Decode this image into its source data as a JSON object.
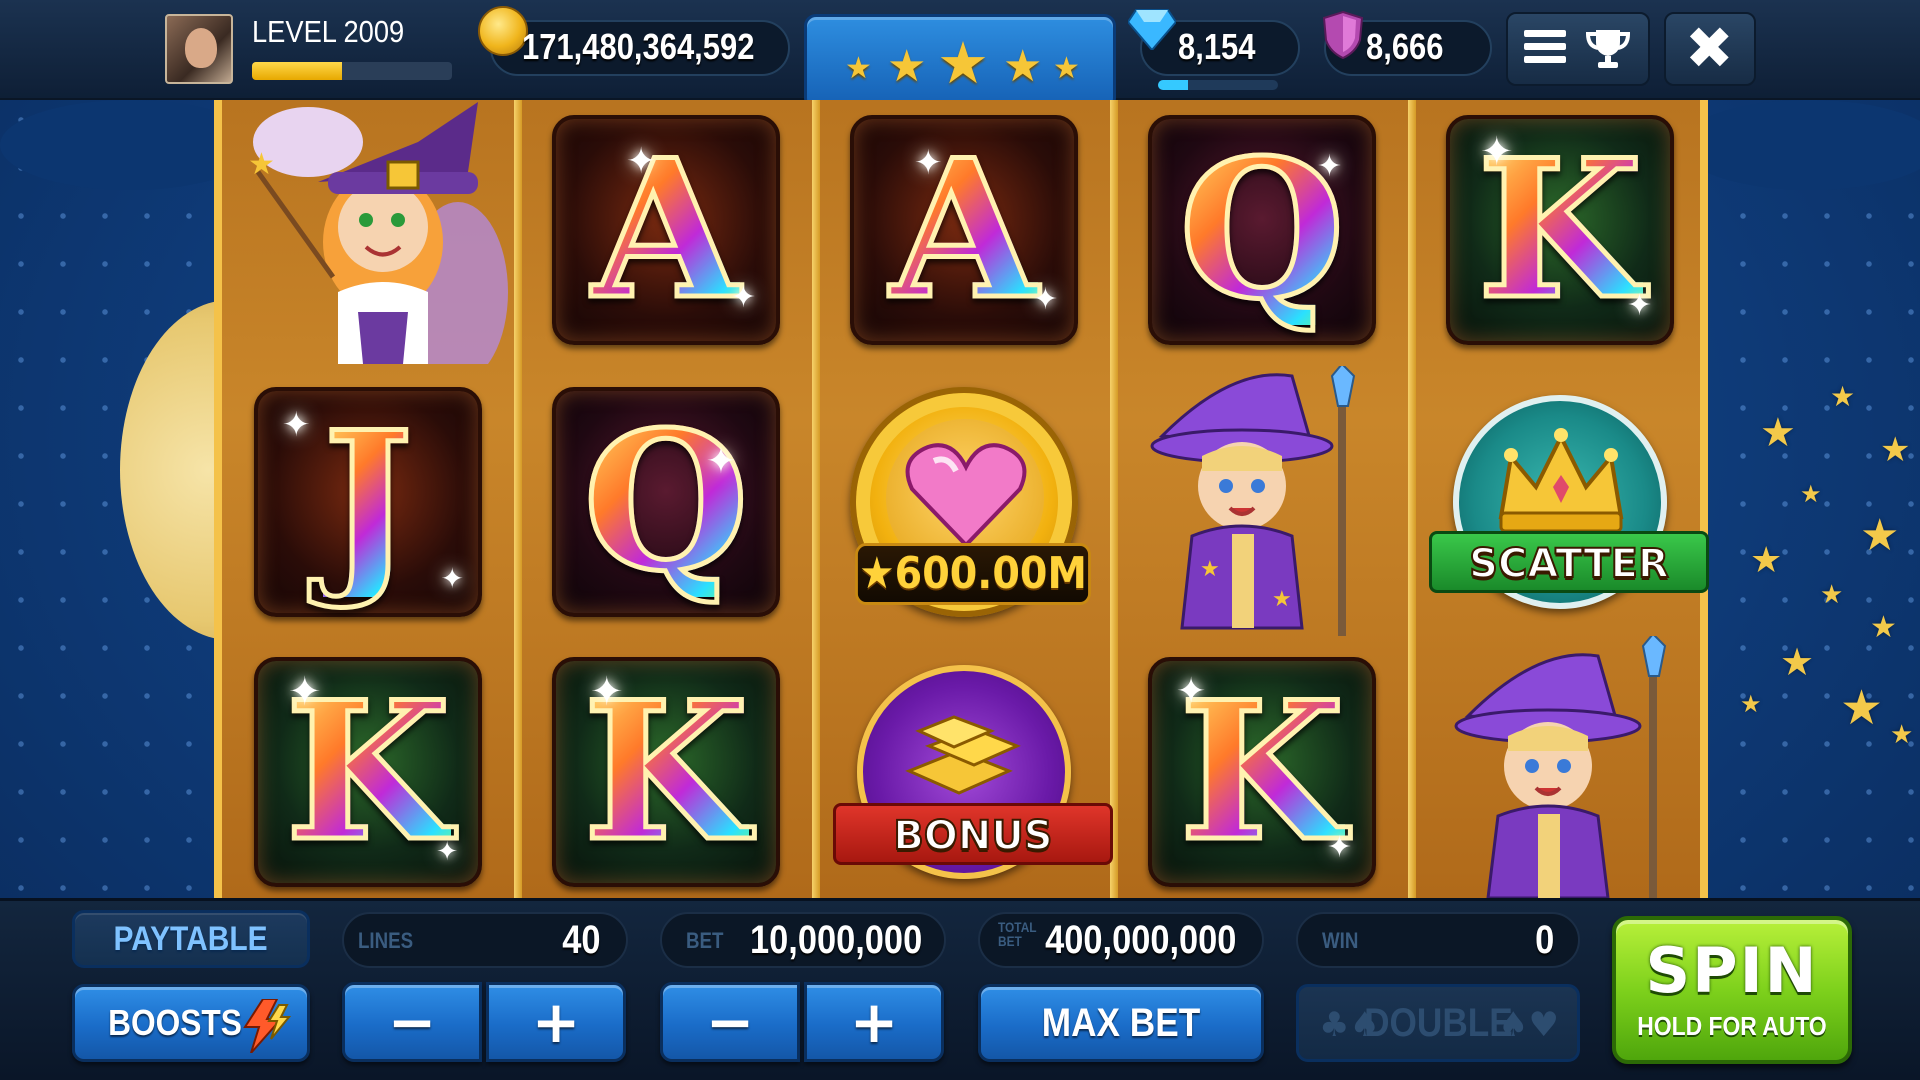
{
  "header": {
    "level_label": "LEVEL 2009",
    "level_progress": 0.45,
    "coins": "171,480,364,592",
    "gems": "8,154",
    "gem_progress": 0.25,
    "shields": "8,666",
    "star_rating": 5,
    "icons": [
      "avatar",
      "coin-icon",
      "gem-icon",
      "shield-icon",
      "menu-icon",
      "trophy-icon",
      "close-icon"
    ]
  },
  "reels": {
    "columns": [
      [
        "fairy",
        "J",
        "K"
      ],
      [
        "A",
        "Q",
        "K"
      ],
      [
        "A",
        "jackpot-heart",
        "bonus"
      ],
      [
        "Q",
        "wizard",
        "K"
      ],
      [
        "K",
        "scatter",
        "wizard"
      ]
    ],
    "jackpot_label": "★600.00M",
    "scatter_label": "SCATTER",
    "bonus_label": "BONUS"
  },
  "controls": {
    "paytable_label": "PAYTABLE",
    "boosts_label": "BOOSTS",
    "lines_label": "LINES",
    "lines_value": "40",
    "bet_label": "BET",
    "bet_value": "10,000,000",
    "total_bet_label": "TOTAL BET",
    "total_bet_value": "400,000,000",
    "win_label": "WIN",
    "win_value": "0",
    "minus": "−",
    "plus": "+",
    "max_bet_label": "MAX BET",
    "double_label": "DOUBLE",
    "spin_label": "SPIN",
    "spin_sub_label": "HOLD FOR AUTO"
  },
  "colors": {
    "accent_blue": "#1a6cc8",
    "spin_green": "#7ed11c",
    "gold": "#f4c24a"
  }
}
